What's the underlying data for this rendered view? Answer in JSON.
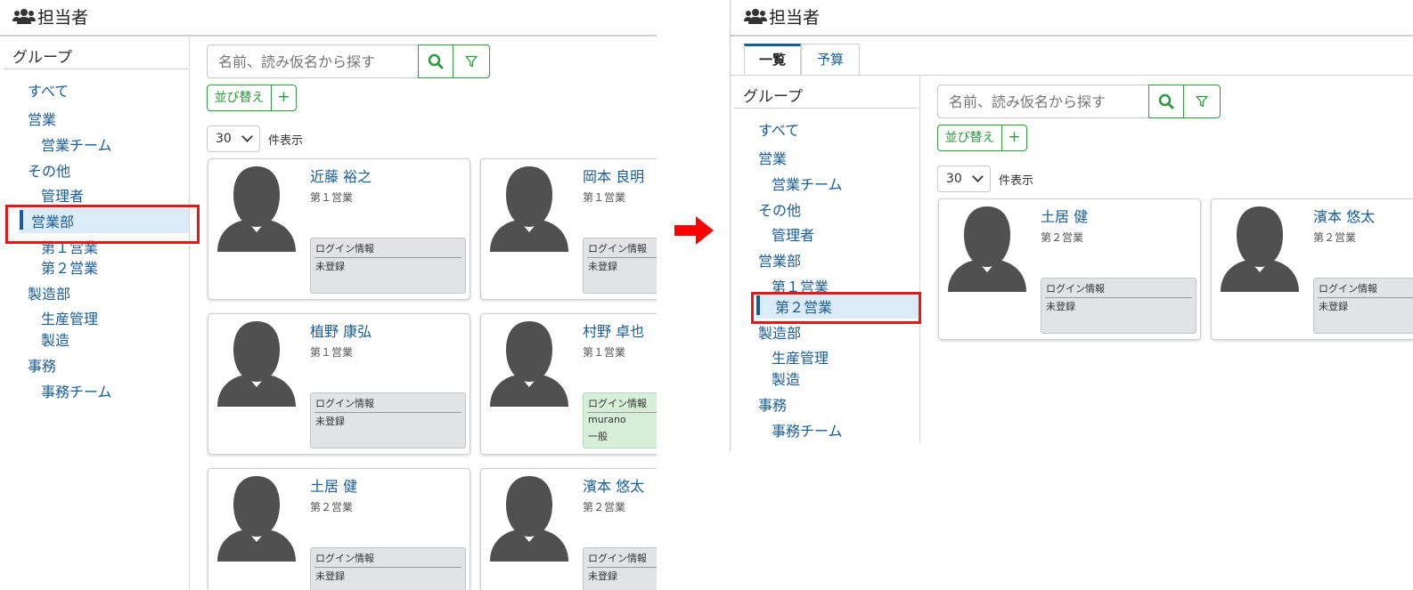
{
  "colors": {
    "link": "#1a5c94",
    "accent_green": "#2f9a3f",
    "highlight_red": "#e31919",
    "selected_bg": "#dcebf8"
  },
  "left": {
    "header_title": "担当者",
    "group_title": "グループ",
    "tree": [
      {
        "label": "すべて",
        "level": 0
      },
      {
        "label": "営業",
        "level": 0
      },
      {
        "label": "営業チーム",
        "level": 1
      },
      {
        "label": "その他",
        "level": 0
      },
      {
        "label": "管理者",
        "level": 1
      },
      {
        "label": "営業部",
        "level": 0,
        "selected": true
      },
      {
        "label": "第１営業",
        "level": 1
      },
      {
        "label": "第２営業",
        "level": 1
      },
      {
        "label": "製造部",
        "level": 0
      },
      {
        "label": "生産管理",
        "level": 1
      },
      {
        "label": "製造",
        "level": 1
      },
      {
        "label": "事務",
        "level": 0
      },
      {
        "label": "事務チーム",
        "level": 1
      }
    ],
    "search_placeholder": "名前、読み仮名から探す",
    "sort_label": "並び替え",
    "add_label": "+",
    "per_page_value": "30",
    "per_page_label": "件表示",
    "cards": [
      {
        "name": "近藤 裕之",
        "dept": "第１営業",
        "login_title": "ログイン情報",
        "login_line1": "未登録",
        "login_line2": "",
        "registered": false
      },
      {
        "name": "岡本 良明",
        "dept": "第１営業",
        "login_title": "ログイン情報",
        "login_line1": "未登録",
        "login_line2": "",
        "registered": false
      },
      {
        "name": "植野 康弘",
        "dept": "第１営業",
        "login_title": "ログイン情報",
        "login_line1": "未登録",
        "login_line2": "",
        "registered": false
      },
      {
        "name": "村野 卓也",
        "dept": "第１営業",
        "login_title": "ログイン情報",
        "login_line1": "murano",
        "login_line2": "一般",
        "registered": true
      },
      {
        "name": "土居 健",
        "dept": "第２営業",
        "login_title": "ログイン情報",
        "login_line1": "未登録",
        "login_line2": "",
        "registered": false
      },
      {
        "name": "濱本 悠太",
        "dept": "第２営業",
        "login_title": "ログイン情報",
        "login_line1": "未登録",
        "login_line2": "",
        "registered": false
      }
    ]
  },
  "right": {
    "header_title": "担当者",
    "tabs": [
      {
        "label": "一覧",
        "active": true
      },
      {
        "label": "予算",
        "active": false
      }
    ],
    "group_title": "グループ",
    "tree": [
      {
        "label": "すべて",
        "level": 0
      },
      {
        "label": "営業",
        "level": 0
      },
      {
        "label": "営業チーム",
        "level": 1
      },
      {
        "label": "その他",
        "level": 0
      },
      {
        "label": "管理者",
        "level": 1
      },
      {
        "label": "営業部",
        "level": 0
      },
      {
        "label": "第１営業",
        "level": 1
      },
      {
        "label": "第２営業",
        "level": 1,
        "selected": true
      },
      {
        "label": "製造部",
        "level": 0
      },
      {
        "label": "生産管理",
        "level": 1
      },
      {
        "label": "製造",
        "level": 1
      },
      {
        "label": "事務",
        "level": 0
      },
      {
        "label": "事務チーム",
        "level": 1
      }
    ],
    "search_placeholder": "名前、読み仮名から探す",
    "sort_label": "並び替え",
    "add_label": "+",
    "per_page_value": "30",
    "per_page_label": "件表示",
    "cards": [
      {
        "name": "土居 健",
        "dept": "第２営業",
        "login_title": "ログイン情報",
        "login_line1": "未登録",
        "login_line2": "",
        "registered": false
      },
      {
        "name": "濱本 悠太",
        "dept": "第２営業",
        "login_title": "ログイン情報",
        "login_line1": "未登録",
        "login_line2": "",
        "registered": false
      }
    ]
  }
}
